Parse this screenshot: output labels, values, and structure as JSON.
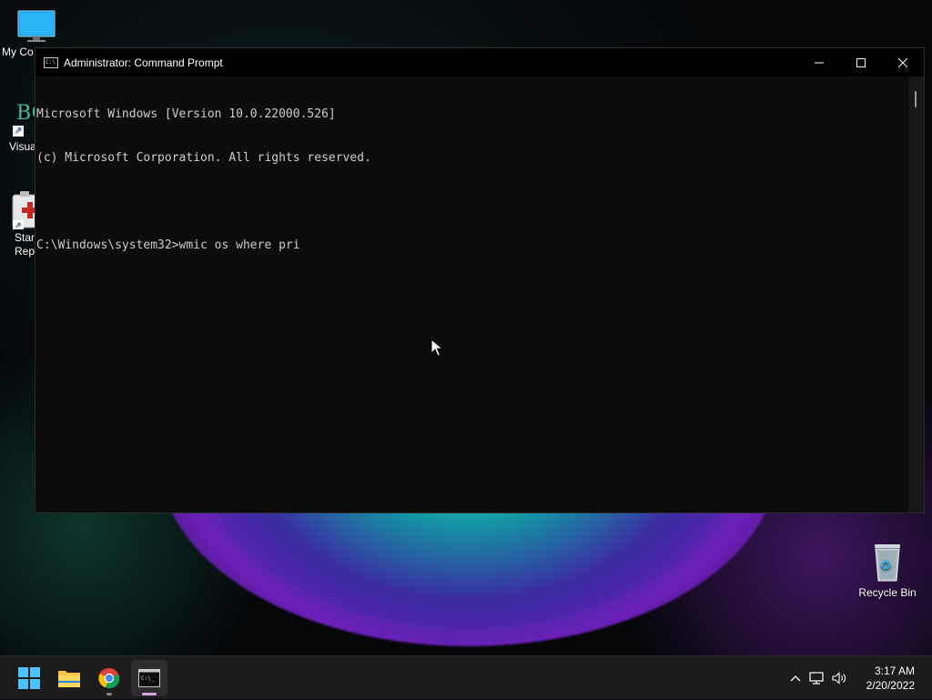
{
  "desktop": {
    "icons": [
      {
        "label": "My Co"
      },
      {
        "label": "Visua"
      },
      {
        "label": "Star"
      },
      {
        "label": "Rep"
      },
      {
        "label": "Recycle Bin"
      }
    ],
    "partial_text": "BC"
  },
  "window": {
    "title": "Administrator: Command Prompt",
    "icon_text": "C:\\",
    "console_lines": [
      "Microsoft Windows [Version 10.0.22000.526]",
      "(c) Microsoft Corporation. All rights reserved.",
      "",
      "C:\\Windows\\system32>wmic os where pri"
    ]
  },
  "taskbar": {
    "clock_time": "3:17 AM",
    "clock_date": "2/20/2022",
    "apps": [
      {
        "icon": "start-icon"
      },
      {
        "icon": "file-explorer-icon"
      },
      {
        "icon": "chrome-icon"
      },
      {
        "icon": "command-prompt-icon"
      }
    ],
    "tray": [
      "chevron-up-icon",
      "network-icon",
      "volume-icon"
    ]
  },
  "colors": {
    "console_bg": "#0c0c0c",
    "console_text": "#cccccc",
    "taskbar_bg": "#1c1c1c",
    "accent": "#0078d4"
  }
}
